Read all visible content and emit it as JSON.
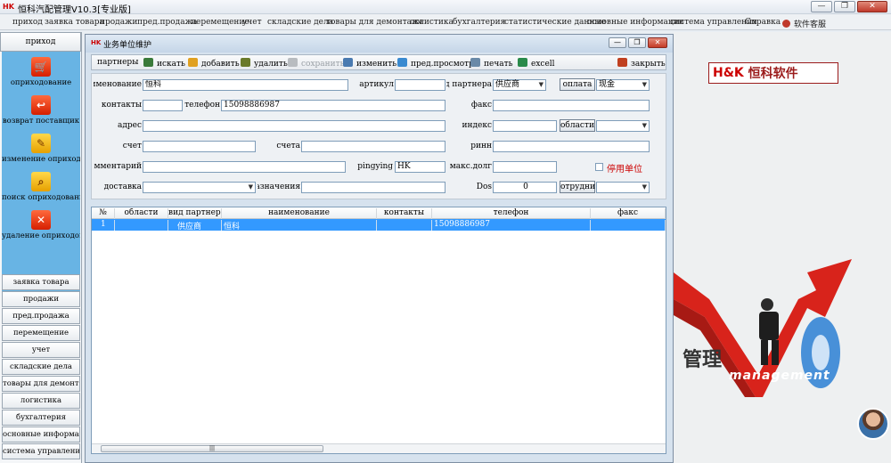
{
  "app": {
    "logo": "HK",
    "title": "恒科汽配管理V10.3[专业版]"
  },
  "window_controls": {
    "minimize": "—",
    "restore": "❐",
    "close": "✕"
  },
  "menu": [
    "приход",
    "заявка товара",
    "продажи",
    "пред.продажа",
    "перемещение",
    "учет",
    "складские дела",
    "товары для демонтажа",
    "логистика",
    "бухгалтерия",
    "статистические данные",
    "основные информации",
    "система управления",
    "Справка",
    "软件客服"
  ],
  "sidebar": {
    "header": "приход",
    "panel_items": [
      {
        "label": "оприходование",
        "icon": "cart-icon"
      },
      {
        "label": "возврат поставщик",
        "icon": "cart-return-icon"
      },
      {
        "label": "изменение оприходования",
        "icon": "edit-icon"
      },
      {
        "label": "поиск оприходование",
        "icon": "search-icon"
      },
      {
        "label": "удаление оприходования",
        "icon": "delete-icon"
      }
    ],
    "buttons": [
      "заявка товара",
      "продажи",
      "пред.продажа",
      "перемещение",
      "учет",
      "складские дела",
      "товары  для демонта...",
      "логистика",
      "бухгалтерия",
      "основные информац...",
      "система управления"
    ]
  },
  "dialog": {
    "logo": "HK",
    "title": "业务单位维护",
    "toolbar": {
      "partners": "партнеры",
      "search": "искать",
      "add": "добавить",
      "delete": "удалить",
      "save": "сохранить",
      "edit": "изменить",
      "preview": "пред.просмотр",
      "print": "печать",
      "excel": "excell",
      "close": "закрыть"
    },
    "form": {
      "name_label": "наименование",
      "name_value": "恒科",
      "article_label": "артикул",
      "article_value": "",
      "partner_type_label": "вид партнера",
      "partner_type_value": "供应商",
      "payment_button": "оплата",
      "payment_value": "现金",
      "contacts_label": "контакты",
      "contacts_value": "",
      "phone_label": "телефон",
      "phone_value": "15098886987",
      "fax_label": "факс",
      "fax_value": "",
      "address_label": "адрес",
      "address_value": "",
      "index_label": "индекс",
      "index_value": "",
      "region_button": "области",
      "region_value": "",
      "account_label": "счет",
      "account_value": "",
      "accounts_label": "счета",
      "accounts_value": "",
      "inn_label": "ринн",
      "inn_value": "",
      "comment_label": "комментарий",
      "comment_value": "",
      "pingying_label": "pingying",
      "pingying_value": "HK",
      "max_debt_label": "макс.долг",
      "max_debt_value": "",
      "disabled_label": "停用单位",
      "delivery_label": "доставка",
      "delivery_value": "",
      "purpose_label": "назначения",
      "purpose_value": "",
      "dos_label": "Dos",
      "dos_value": "0",
      "employee_button": "отрудни",
      "employee_value": ""
    },
    "grid": {
      "headers": [
        "№",
        "области",
        "вид партнера",
        "наименование",
        "контакты",
        "телефон",
        "факс"
      ],
      "rows": [
        {
          "no": "1",
          "region": "",
          "type": "供应商",
          "name": "恒科",
          "contacts": "",
          "phone": "15098886987",
          "fax": ""
        }
      ]
    }
  },
  "desktop": {
    "brand": "H&K",
    "brand_cn": "恒科软件",
    "slogan_cn": "管理",
    "slogan_en": "management"
  }
}
